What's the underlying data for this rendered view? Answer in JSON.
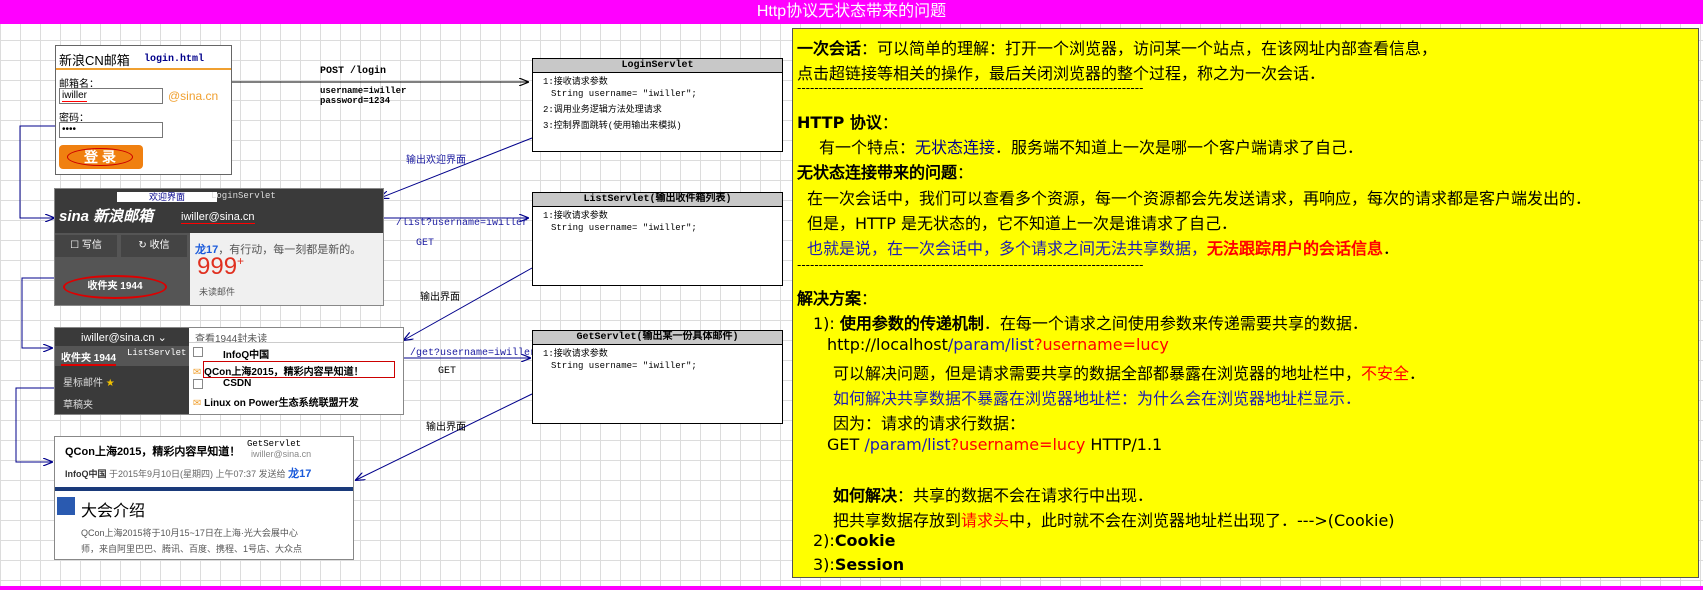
{
  "title": "Http协议无状态带来的问题",
  "login_box": {
    "brand": "新浪CN邮箱",
    "file": "login.html",
    "email_label": "邮箱名：",
    "email_value": "iwiller",
    "domain": "@sina.cn",
    "password_label": "密码：",
    "password_value": "••••",
    "login_button": "登 录"
  },
  "arrows": {
    "post_label": "POST  /login",
    "post_params": [
      "username=iwiller",
      "password=1234"
    ],
    "welcome_label": "输出欢迎界面",
    "list_url": "/list?username=iwiller",
    "list_method": "GET",
    "out_label": "输出界面",
    "get_url": "/get?username=iwiller",
    "get_method": "GET",
    "out_label2": "输出界面"
  },
  "servlets": {
    "login": {
      "title": "LoginServlet",
      "lines": [
        "1:接收请求参数",
        "  String username= \"iwiller\";",
        "2:调用业务逻辑方法处理请求",
        "3:控制界面跳转(使用输出来模拟)"
      ]
    },
    "list": {
      "title": "ListServlet(输出收件箱列表)",
      "lines": [
        "1:接收请求参数",
        "  String username= \"iwiller\";"
      ]
    },
    "get": {
      "title": "GetServlet(输出某一份具体邮件)",
      "lines": [
        "1:接收请求参数",
        "  String username= \"iwiller\";"
      ]
    }
  },
  "welcome_shot": {
    "tag": "欢迎界面",
    "servlet": "LoginServlet",
    "brand": "sina 新浪邮箱",
    "user": "iwiller@sina.cn",
    "write": "写信",
    "receive": "收信",
    "long17": "龙17",
    "slogan": "，有行动，每一刻都是新的。",
    "count": "999",
    "unread": "未读邮件",
    "inbox": "收件夹 1944"
  },
  "list_shot": {
    "user": "iwiller@sina.cn",
    "inbox": "收件夹 1944",
    "servlet": "ListServlet",
    "starred": "星标邮件",
    "drafts": "草稿夹",
    "header": "查看1944封未读",
    "rows": [
      "InfoQ中国",
      "QCon上海2015，精彩内容早知道！",
      "CSDN",
      "Linux on Power生态系统联盟开发"
    ]
  },
  "get_shot": {
    "subject": "QCon上海2015，精彩内容早知道！",
    "servlet": "GetServlet",
    "from": "InfoQ中国",
    "date": "于2015年9月10日(星期四) 上午07:37 发送给",
    "to": "龙17",
    "user": "iwiller@sina.cn",
    "section": "大会介绍",
    "body": [
      "QCon上海2015将于10月15~17日在上海·光大会展中心",
      "师，来自阿里巴巴、腾讯、百度、携程、1号店、大众点"
    ]
  },
  "notes": {
    "p1": {
      "term": "一次会话",
      "rest1": "：可以简单的理解：打开一个浏览器，访问某一个站点，在该网址内部查看信息，",
      "line2": "点击超链接等相关的操作，最后关闭浏览器的整个过程，称之为一次会话．"
    },
    "sep": "--------------------------------------------------------------------------------",
    "http_title": "HTTP 协议",
    "http_colon": "：",
    "feature_pre": "有一个特点：",
    "feature_key": "无状态连接",
    "feature_post": "．服务端不知道上一次是哪一个客户端请求了自己．",
    "problem_title": "无状态连接带来的问题",
    "problem_colon": "：",
    "problem_1": "在一次会话中，我们可以查看多个资源，每一个资源都会先发送请求，再响应，每次的请求都是客户端发出的．",
    "problem_2": "但是，HTTP 是无状态的，它不知道上一次是谁请求了自己．",
    "problem_3a": "也就是说，在一次会话中，多个请求之间无法共享数据，",
    "problem_3b": "无法跟踪用户的会话信息",
    "problem_3c": "．",
    "solution_title": "解决方案",
    "solution_colon": "：",
    "s1_num": "1): ",
    "s1_title": "使用参数的传递机制",
    "s1_rest": "．在每一个请求之间使用参数来传递需要共享的数据．",
    "url_a": "http://localhost",
    "url_b": "/param/list",
    "url_c": "?username=lucy",
    "s1_l1a": "可以解决问题，但是请求需要共享的数据全部都暴露在浏览器的地址栏中，",
    "s1_l1b": "不安全",
    "s1_l1c": "．",
    "s1_l2": "如何解决共享数据不暴露在浏览器地址栏：为什么会在浏览器地址栏显示．",
    "s1_l3": "因为：请求的请求行数据：",
    "get_a": "GET ",
    "get_b": "/param/list",
    "get_c": "?username=lucy",
    "get_d": " HTTP/1.1",
    "how_title": "如何解决",
    "how_rest": "：共享的数据不会在请求行中出现．",
    "how_2a": "把共享数据存放到",
    "how_2b": "请求头",
    "how_2c": "中，此时就不会在浏览器地址栏出现了．--->(Cookie)",
    "s2_num": "2):",
    "s2_title": "Cookie",
    "s3_num": "3):",
    "s3_title": "Session"
  }
}
